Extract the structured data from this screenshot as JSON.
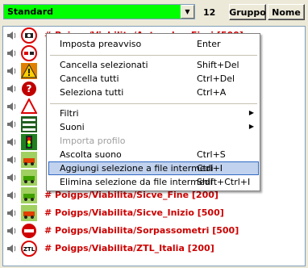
{
  "toolbar": {
    "combo_value": "Standard",
    "count": "12",
    "gruppo_label": "Gruppo",
    "nome_label": "Nome"
  },
  "rows": [
    {
      "text": "# Poigps/Viabilita/Autovelox_Fissi [500]",
      "icon": "autovelox-icon"
    },
    {
      "text": "",
      "icon": "no-overtaking-icon"
    },
    {
      "text": "",
      "icon": "warning-icon"
    },
    {
      "text": "",
      "icon": "question-icon"
    },
    {
      "text": "",
      "icon": "triangle-icon"
    },
    {
      "text": "",
      "icon": "level-crossing-icon"
    },
    {
      "text": "",
      "icon": "traffic-light-icon"
    },
    {
      "text": "",
      "icon": "tutor-icon"
    },
    {
      "text": "",
      "icon": "car-icon"
    },
    {
      "text": "# Poigps/Viabilita/Sicve_Fine [200]",
      "icon": "sicve-fine-icon"
    },
    {
      "text": "# Poigps/Viabilita/Sicve_Inizio [500]",
      "icon": "sicve-inizio-icon"
    },
    {
      "text": "# Poigps/Viabilita/Sorpassometri [500]",
      "icon": "sorpassometri-icon"
    },
    {
      "text": "# Poigps/Viabilita/ZTL_Italia [200]",
      "icon": "ztl-icon"
    }
  ],
  "menu": {
    "items": [
      {
        "label": "Imposta preavviso",
        "shortcut": "Enter"
      },
      {
        "label": "Cancella selezionati",
        "shortcut": "Shift+Del"
      },
      {
        "label": "Cancella tutti",
        "shortcut": "Ctrl+Del"
      },
      {
        "label": "Seleziona tutti",
        "shortcut": "Ctrl+A"
      },
      {
        "label": "Filtri",
        "shortcut": ""
      },
      {
        "label": "Suoni",
        "shortcut": ""
      },
      {
        "label": "Importa profilo",
        "shortcut": ""
      },
      {
        "label": "Ascolta suono",
        "shortcut": "Ctrl+S"
      },
      {
        "label": "Aggiungi selezione a file intermedi",
        "shortcut": "Ctrl+I"
      },
      {
        "label": "Elimina selezione da file intermedi",
        "shortcut": "Shift+Ctrl+I"
      }
    ],
    "arrow": "▶"
  },
  "colors": {
    "combo_bg": "#00ff00",
    "row_text": "#cc0000",
    "menu_hover": "#c1d2ee"
  }
}
